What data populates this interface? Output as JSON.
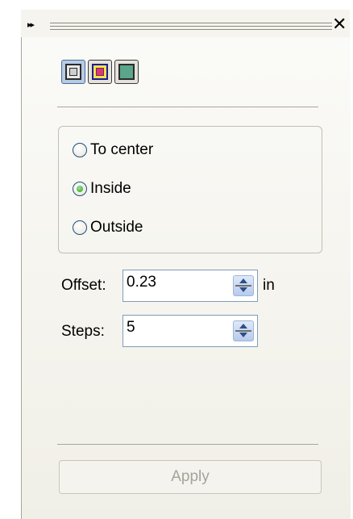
{
  "title_bar": {
    "collapse_glyph": "▸▸",
    "close_glyph": "✕"
  },
  "modes": [
    {
      "icon": "contour-to-center-icon",
      "selected": true
    },
    {
      "icon": "contour-inside-icon",
      "selected": false
    },
    {
      "icon": "contour-outside-icon",
      "selected": false
    }
  ],
  "direction": {
    "options": [
      {
        "label": "To center",
        "selected": false
      },
      {
        "label": "Inside",
        "selected": true
      },
      {
        "label": "Outside",
        "selected": false
      }
    ]
  },
  "offset": {
    "label": "Offset:",
    "value": "0.23",
    "unit": "in"
  },
  "steps": {
    "label": "Steps:",
    "value": "5"
  },
  "apply_label": "Apply",
  "colors": {
    "selected_accent": "#b7cbe5",
    "radio_on": "#2a9d23",
    "field_border": "#7f9db9"
  }
}
